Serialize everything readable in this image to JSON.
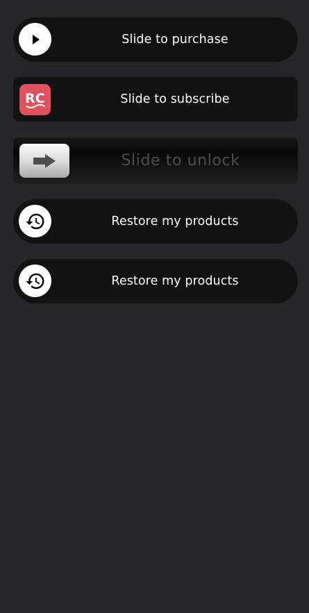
{
  "sliders": [
    {
      "label": "Slide to purchase",
      "icon": "play-icon"
    },
    {
      "label": "Slide to subscribe",
      "icon": "rc-logo",
      "logo_text": "RC",
      "logo_color": "#e0505e"
    },
    {
      "label": "Slide to unlock",
      "icon": "arrow-right-icon"
    },
    {
      "label": "Restore my products",
      "icon": "history-icon"
    },
    {
      "label": "Restore my products",
      "icon": "history-icon"
    }
  ],
  "colors": {
    "background": "#262628",
    "slider_track": "#121212",
    "label_text": "#ffffff",
    "unlock_text": "#4d4d4d"
  }
}
